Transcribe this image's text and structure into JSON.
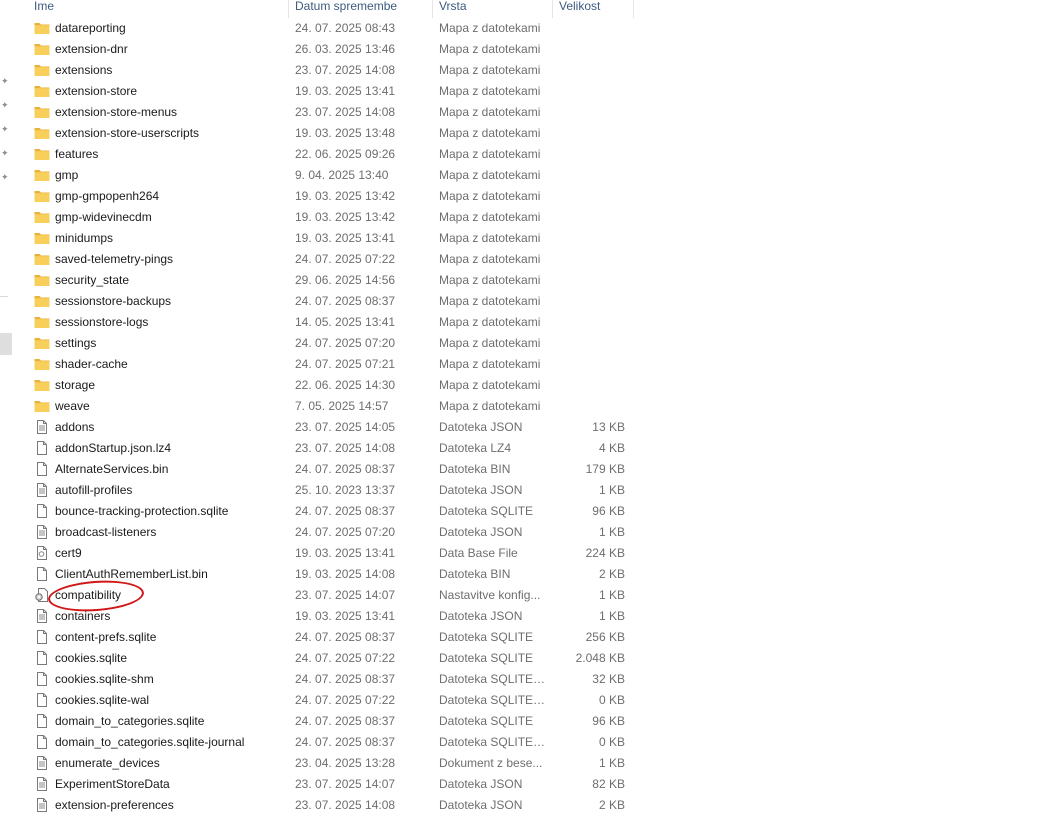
{
  "columns": {
    "name": "Ime",
    "date": "Datum spremembe",
    "type": "Vrsta",
    "size": "Velikost"
  },
  "colors": {
    "folder": "#f3c24f",
    "annotation": "#d01616"
  },
  "files": [
    {
      "name": "datareporting",
      "date": "24. 07. 2025 08:43",
      "type": "Mapa z datotekami",
      "size": "",
      "icon": "folder-icon"
    },
    {
      "name": "extension-dnr",
      "date": "26. 03. 2025 13:46",
      "type": "Mapa z datotekami",
      "size": "",
      "icon": "folder-icon"
    },
    {
      "name": "extensions",
      "date": "23. 07. 2025 14:08",
      "type": "Mapa z datotekami",
      "size": "",
      "icon": "folder-icon"
    },
    {
      "name": "extension-store",
      "date": "19. 03. 2025 13:41",
      "type": "Mapa z datotekami",
      "size": "",
      "icon": "folder-icon"
    },
    {
      "name": "extension-store-menus",
      "date": "23. 07. 2025 14:08",
      "type": "Mapa z datotekami",
      "size": "",
      "icon": "folder-icon"
    },
    {
      "name": "extension-store-userscripts",
      "date": "19. 03. 2025 13:48",
      "type": "Mapa z datotekami",
      "size": "",
      "icon": "folder-icon"
    },
    {
      "name": "features",
      "date": "22. 06. 2025 09:26",
      "type": "Mapa z datotekami",
      "size": "",
      "icon": "folder-icon"
    },
    {
      "name": "gmp",
      "date": "9. 04. 2025 13:40",
      "type": "Mapa z datotekami",
      "size": "",
      "icon": "folder-icon"
    },
    {
      "name": "gmp-gmpopenh264",
      "date": "19. 03. 2025 13:42",
      "type": "Mapa z datotekami",
      "size": "",
      "icon": "folder-icon"
    },
    {
      "name": "gmp-widevinecdm",
      "date": "19. 03. 2025 13:42",
      "type": "Mapa z datotekami",
      "size": "",
      "icon": "folder-icon"
    },
    {
      "name": "minidumps",
      "date": "19. 03. 2025 13:41",
      "type": "Mapa z datotekami",
      "size": "",
      "icon": "folder-icon"
    },
    {
      "name": "saved-telemetry-pings",
      "date": "24. 07. 2025 07:22",
      "type": "Mapa z datotekami",
      "size": "",
      "icon": "folder-icon"
    },
    {
      "name": "security_state",
      "date": "29. 06. 2025 14:56",
      "type": "Mapa z datotekami",
      "size": "",
      "icon": "folder-icon"
    },
    {
      "name": "sessionstore-backups",
      "date": "24. 07. 2025 08:37",
      "type": "Mapa z datotekami",
      "size": "",
      "icon": "folder-icon"
    },
    {
      "name": "sessionstore-logs",
      "date": "14. 05. 2025 13:41",
      "type": "Mapa z datotekami",
      "size": "",
      "icon": "folder-icon"
    },
    {
      "name": "settings",
      "date": "24. 07. 2025 07:20",
      "type": "Mapa z datotekami",
      "size": "",
      "icon": "folder-icon"
    },
    {
      "name": "shader-cache",
      "date": "24. 07. 2025 07:21",
      "type": "Mapa z datotekami",
      "size": "",
      "icon": "folder-icon"
    },
    {
      "name": "storage",
      "date": "22. 06. 2025 14:30",
      "type": "Mapa z datotekami",
      "size": "",
      "icon": "folder-icon"
    },
    {
      "name": "weave",
      "date": "7. 05. 2025 14:57",
      "type": "Mapa z datotekami",
      "size": "",
      "icon": "folder-icon"
    },
    {
      "name": "addons",
      "date": "23. 07. 2025 14:05",
      "type": "Datoteka JSON",
      "size": "13 KB",
      "icon": "text-file-icon"
    },
    {
      "name": "addonStartup.json.lz4",
      "date": "23. 07. 2025 14:08",
      "type": "Datoteka LZ4",
      "size": "4 KB",
      "icon": "file-icon"
    },
    {
      "name": "AlternateServices.bin",
      "date": "24. 07. 2025 08:37",
      "type": "Datoteka BIN",
      "size": "179 KB",
      "icon": "file-icon"
    },
    {
      "name": "autofill-profiles",
      "date": "25. 10. 2023 13:37",
      "type": "Datoteka JSON",
      "size": "1 KB",
      "icon": "text-file-icon"
    },
    {
      "name": "bounce-tracking-protection.sqlite",
      "date": "24. 07. 2025 08:37",
      "type": "Datoteka SQLITE",
      "size": "96 KB",
      "icon": "file-icon"
    },
    {
      "name": "broadcast-listeners",
      "date": "24. 07. 2025 07:20",
      "type": "Datoteka JSON",
      "size": "1 KB",
      "icon": "text-file-icon"
    },
    {
      "name": "cert9",
      "date": "19. 03. 2025 13:41",
      "type": "Data Base File",
      "size": "224 KB",
      "icon": "database-file-icon"
    },
    {
      "name": "ClientAuthRememberList.bin",
      "date": "19. 03. 2025 14:08",
      "type": "Datoteka BIN",
      "size": "2 KB",
      "icon": "file-icon"
    },
    {
      "name": "compatibility",
      "date": "23. 07. 2025 14:07",
      "type": "Nastavitve konfig...",
      "size": "1 KB",
      "icon": "settings-file-icon"
    },
    {
      "name": "containers",
      "date": "19. 03. 2025 13:41",
      "type": "Datoteka JSON",
      "size": "1 KB",
      "icon": "text-file-icon"
    },
    {
      "name": "content-prefs.sqlite",
      "date": "24. 07. 2025 08:37",
      "type": "Datoteka SQLITE",
      "size": "256 KB",
      "icon": "file-icon"
    },
    {
      "name": "cookies.sqlite",
      "date": "24. 07. 2025 07:22",
      "type": "Datoteka SQLITE",
      "size": "2.048 KB",
      "icon": "file-icon"
    },
    {
      "name": "cookies.sqlite-shm",
      "date": "24. 07. 2025 08:37",
      "type": "Datoteka SQLITE-...",
      "size": "32 KB",
      "icon": "file-icon"
    },
    {
      "name": "cookies.sqlite-wal",
      "date": "24. 07. 2025 07:22",
      "type": "Datoteka SQLITE-...",
      "size": "0 KB",
      "icon": "file-icon"
    },
    {
      "name": "domain_to_categories.sqlite",
      "date": "24. 07. 2025 08:37",
      "type": "Datoteka SQLITE",
      "size": "96 KB",
      "icon": "file-icon"
    },
    {
      "name": "domain_to_categories.sqlite-journal",
      "date": "24. 07. 2025 08:37",
      "type": "Datoteka SQLITE-J...",
      "size": "0 KB",
      "icon": "file-icon"
    },
    {
      "name": "enumerate_devices",
      "date": "23. 04. 2025 13:28",
      "type": "Dokument z bese...",
      "size": "1 KB",
      "icon": "text-file-icon"
    },
    {
      "name": "ExperimentStoreData",
      "date": "23. 07. 2025 14:07",
      "type": "Datoteka JSON",
      "size": "82 KB",
      "icon": "text-file-icon"
    },
    {
      "name": "extension-preferences",
      "date": "23. 07. 2025 14:08",
      "type": "Datoteka JSON",
      "size": "2 KB",
      "icon": "text-file-icon"
    }
  ]
}
